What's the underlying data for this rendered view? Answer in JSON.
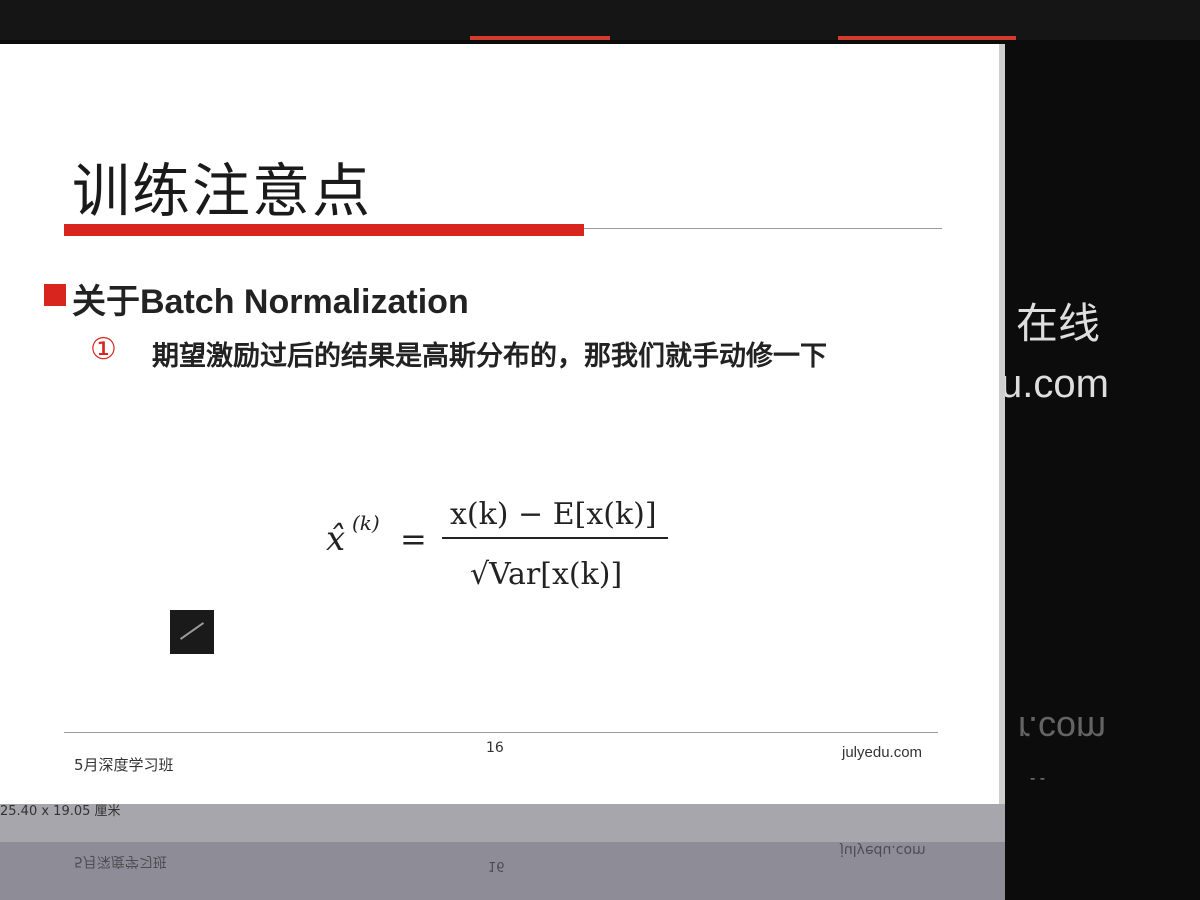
{
  "window": {
    "tab_text": ""
  },
  "background": {
    "site_name": "在线",
    "site_domain": "u.com",
    "mirrored_domain": "r.com",
    "dash": "- -"
  },
  "slide": {
    "title": "训练注意点",
    "heading": "关于Batch Normalization",
    "item_number": "①",
    "item_text": "期望激励过后的结果是高斯分布的，那我们就手动修一下",
    "formula": {
      "lhs": "x̂",
      "superscript": "(k)",
      "equals": "=",
      "numerator": "x(k) − E[x(k)]",
      "denominator": "√Var[x(k)]"
    },
    "footer": {
      "left": "5月深度学习班",
      "page": "16",
      "right": "julyedu.com"
    }
  },
  "status": {
    "dimensions": "25.40 x 19.05 厘米",
    "ghost_left": "5月深度学习班",
    "ghost_page": "16",
    "ghost_right": "julyedu.com"
  },
  "colors": {
    "accent_red": "#d8261f",
    "slide_bg": "#ffffff",
    "outer_bg": "#0c0c0c"
  }
}
